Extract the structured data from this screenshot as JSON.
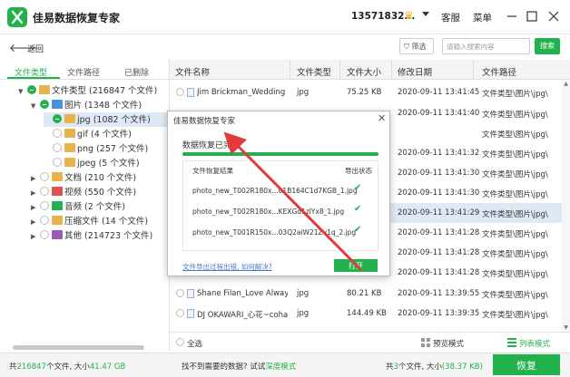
{
  "window": {
    "title": "佳易数据恢复专家",
    "phone": "13571832...",
    "service_label": "客服",
    "menu_label": "菜单"
  },
  "toolbar": {
    "back_label": "返回",
    "filter_label": "筛选",
    "search_placeholder": "请输入搜索内容",
    "search_button": "搜索"
  },
  "left_tabs": [
    "文件类型",
    "文件路径",
    "已删除"
  ],
  "tree": [
    {
      "label": "文件类型 (216847 个文件)",
      "level": 0,
      "expanded": true,
      "icon_color": "#e8b34a"
    },
    {
      "label": "图片 (1348 个文件)",
      "level": 1,
      "expanded": true,
      "icon_color": "#4a90e2"
    },
    {
      "label": "jpg (1082 个文件)",
      "level": 2,
      "selected": true,
      "icon_color": "#e8b34a"
    },
    {
      "label": "gif (4 个文件)",
      "level": 2,
      "icon_color": "#e8b34a"
    },
    {
      "label": "png (257 个文件)",
      "level": 2,
      "icon_color": "#e8b34a"
    },
    {
      "label": "jpeg (5 个文件)",
      "level": 2,
      "icon_color": "#e8b34a"
    },
    {
      "label": "文档 (210 个文件)",
      "level": 1,
      "icon_color": "#e8b34a"
    },
    {
      "label": "视频 (550 个文件)",
      "level": 1,
      "icon_color": "#e05252"
    },
    {
      "label": "音频 (2 个文件)",
      "level": 1,
      "icon_color": "#23b14d"
    },
    {
      "label": "压缩文件 (14 个文件)",
      "level": 1,
      "icon_color": "#e8b34a"
    },
    {
      "label": "其他 (214723 个文件)",
      "level": 1,
      "icon_color": "#9b59b6"
    }
  ],
  "table": {
    "headers": [
      "文件名称",
      "文件类型",
      "文件大小",
      "修改日期",
      "文件路径"
    ],
    "rows": [
      {
        "name": "Jim Brickman_Wedding S...",
        "type": "jpg",
        "size": "75.25 KB",
        "date": "2020-09-11 13:41:45",
        "path": "文件类型\\图片\\jpg\\"
      },
      {
        "name": "",
        "type": "",
        "size": "",
        "date": "2020-09-11 13:41:40",
        "path": "文件类型\\图片\\jpg\\"
      },
      {
        "name": "",
        "type": "",
        "size": "",
        "date": "",
        "path": "文件类型\\图片\\jpg\\"
      },
      {
        "name": "",
        "type": "",
        "size": "",
        "date": "2020-09-11 13:41:32",
        "path": "文件类型\\图片\\jpg\\"
      },
      {
        "name": "",
        "type": "",
        "size": "",
        "date": "2020-09-11 13:41:30",
        "path": "文件类型\\图片\\jpg\\"
      },
      {
        "name": "",
        "type": "",
        "size": "",
        "date": "2020-09-11 13:41:30",
        "path": "文件类型\\图片\\jpg\\"
      },
      {
        "name": "",
        "type": "",
        "size": "",
        "date": "2020-09-11 13:41:29",
        "path": "文件类型\\图片\\jpg\\"
      },
      {
        "name": "",
        "type": "",
        "size": "",
        "date": "2020-09-11 13:41:28",
        "path": "文件类型\\图片\\jpg\\"
      },
      {
        "name": "",
        "type": "",
        "size": "",
        "date": "2020-09-11 13:41:28",
        "path": "文件类型\\图片\\jpg\\"
      },
      {
        "name": "",
        "type": "",
        "size": "",
        "date": "2020-09-11 13:41:28",
        "path": "文件类型\\图片\\jpg\\"
      },
      {
        "name": "Shane Filan_Love Always_...",
        "type": "jpg",
        "size": "80.21 KB",
        "date": "2020-09-11 13:39:55",
        "path": "文件类型\\图片\\jpg\\"
      },
      {
        "name": "DJ OKAWARI_心花~coha...",
        "type": "jpg",
        "size": "144.49 KB",
        "date": "2020-09-11 13:39:35",
        "path": "文件类型\\图片\\jpg\\"
      }
    ]
  },
  "list_footer": {
    "select_all": "全选",
    "preview_mode": "预览模式",
    "list_mode": "列表模式"
  },
  "status": {
    "total_prefix": "共",
    "total_count": "216847",
    "total_mid": "个文件, 大小",
    "total_size": "41.47 GB",
    "not_found": "找不到需要的数据? 试试",
    "deep_scan": "深度模式",
    "sel_prefix": "共",
    "sel_count": "3",
    "sel_mid": "个文件, 大小",
    "sel_size": "(38.37 KB)",
    "recover_button": "恢复"
  },
  "dialog": {
    "title": "佳易数据恢复专家",
    "heading": "数据恢复已完成",
    "progress": 1.0,
    "col_result": "文件恢复结果",
    "col_status": "导出状态",
    "files": [
      "photo_new_T002R180x...01B164C1d7KGB_1.jpg",
      "photo_new_T002R180x...KEXGd1zlYx8_1.jpg",
      "photo_new_T001R150x...03Q2aiW21Zv1q_2.jpg"
    ],
    "help_link": "文件导出过程出错, 如何解决?",
    "open_button": "打开"
  },
  "colors": {
    "accent": "#23b14d",
    "arrow": "#e03a3a",
    "selected_row": "#dfe9f5"
  }
}
